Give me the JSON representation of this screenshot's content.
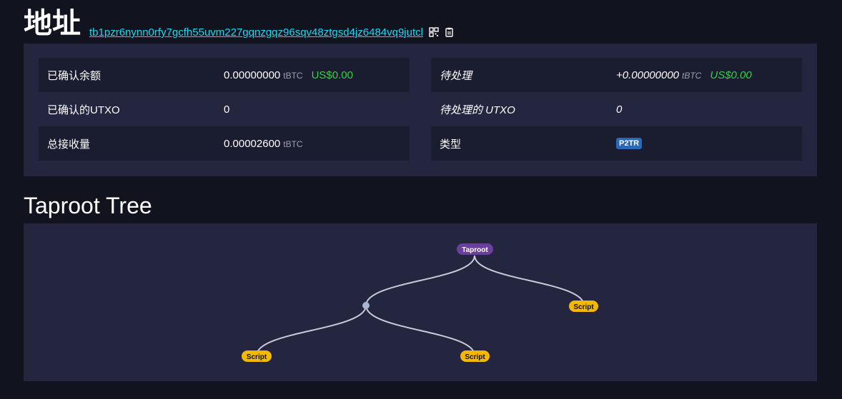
{
  "header": {
    "title": "地址",
    "address": "tb1pzr6nynn0rfy7gcfh55uvm227gqnzgqz96sqv48ztgsd4jz6484vq9jutcl",
    "icons": [
      "qr-code-icon",
      "copy-icon"
    ]
  },
  "summary": {
    "confirmed_balance_label": "已确认余额",
    "confirmed_balance_value": "0.00000000",
    "confirmed_balance_unit": "tBTC",
    "confirmed_balance_usd": "US$0.00",
    "confirmed_utxo_label": "已确认的UTXO",
    "confirmed_utxo_value": "0",
    "total_received_label": "总接收量",
    "total_received_value": "0.00002600",
    "total_received_unit": "tBTC",
    "pending_label": "待处理",
    "pending_value": "+0.00000000",
    "pending_unit": "tBTC",
    "pending_usd": "US$0.00",
    "pending_utxo_label": "待处理的 UTXO",
    "pending_utxo_value": "0",
    "type_label": "类型",
    "type_value": "P2TR"
  },
  "taproot": {
    "section_title": "Taproot Tree",
    "root_label": "Taproot",
    "leaf_label": "Script",
    "colors": {
      "root": "#6b3fa0",
      "leaf": "#f5b800",
      "edge": "#c8ccd6",
      "branch_node": "#a8b6d4"
    }
  }
}
